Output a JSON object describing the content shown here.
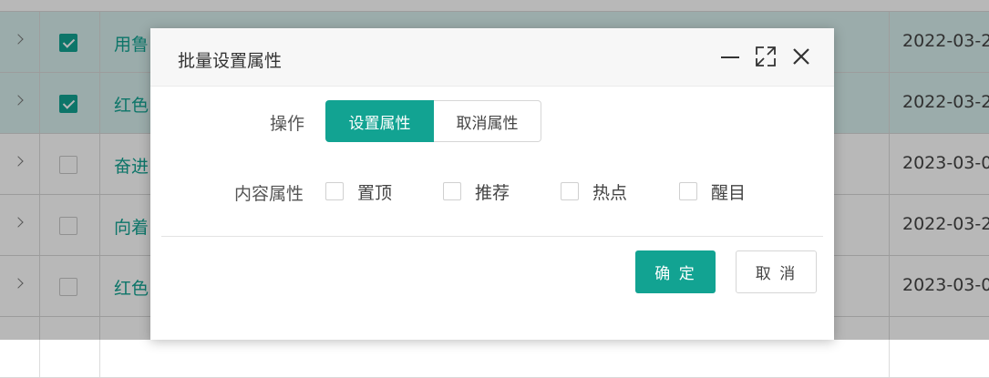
{
  "background_table": {
    "rows": [
      {
        "title": "用鲁",
        "date": "2022-03-2",
        "checked": true,
        "selected": true
      },
      {
        "title": "红色",
        "date": "2022-03-2",
        "checked": true,
        "selected": true
      },
      {
        "title": "奋进",
        "date": "2023-03-0",
        "checked": false,
        "selected": false
      },
      {
        "title": "向着",
        "date": "2022-03-2",
        "checked": false,
        "selected": false
      },
      {
        "title": "红色",
        "date": "2023-03-0",
        "checked": false,
        "selected": false
      }
    ]
  },
  "dialog": {
    "title": "批量设置属性",
    "operation_label": "操作",
    "operation_options": {
      "set": "设置属性",
      "unset": "取消属性"
    },
    "operation_selected": "设置属性",
    "content_attr_label": "内容属性",
    "attributes": [
      {
        "label": "置顶",
        "checked": false
      },
      {
        "label": "推荐",
        "checked": false
      },
      {
        "label": "热点",
        "checked": false
      },
      {
        "label": "醒目",
        "checked": false
      }
    ],
    "confirm_label": "确 定",
    "cancel_label": "取 消"
  },
  "colors": {
    "accent": "#12a392"
  },
  "icons": [
    "minimize-icon",
    "maximize-icon",
    "close-icon",
    "chevron-right-icon",
    "checkmark-icon"
  ]
}
